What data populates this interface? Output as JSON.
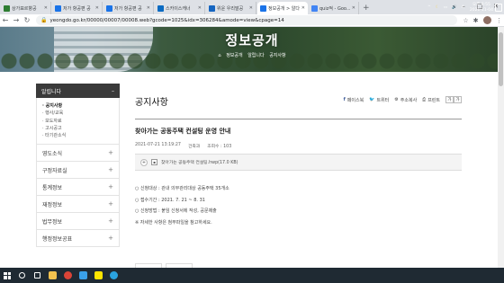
{
  "browser": {
    "tabs": [
      {
        "title": "상가표르향공",
        "color": "#2e7d32",
        "active": false
      },
      {
        "title": "저가 항공편 공",
        "color": "#1a73e8",
        "active": false
      },
      {
        "title": "저가 항공편 공",
        "color": "#1a73e8",
        "active": false
      },
      {
        "title": "스카이스캐너",
        "color": "#0b6bc2",
        "active": false
      },
      {
        "title": "위운 우리말공",
        "color": "#1565c0",
        "active": false
      },
      {
        "title": "정보공개 > 알다",
        "color": "#1a73e8",
        "active": true
      },
      {
        "title": "quiz적 - Goo...",
        "color": "#4285f4",
        "active": false
      }
    ],
    "url": "yeongdo.go.kr/00000/00007/00008.web?gcode=1025&idx=306284&amode=view&cpage=14",
    "new_tab": "+",
    "window_controls": [
      "–",
      "□",
      "✕"
    ]
  },
  "hero": {
    "title": "정보공개",
    "breadcrumb": [
      "⌂",
      "정보공개",
      "알립니다",
      "공지사항"
    ]
  },
  "sidebar": {
    "title": "알립니다",
    "collapse": "–",
    "subitems": [
      {
        "label": "· 공지사항",
        "current": true
      },
      {
        "label": "· 행사/교육",
        "current": false
      },
      {
        "label": "· 보도자료",
        "current": false
      },
      {
        "label": "· 고시공고",
        "current": false
      },
      {
        "label": "· 타기관소식",
        "current": false
      }
    ],
    "categories": [
      "영도소식",
      "구정자료실",
      "통계정보",
      "재정정보",
      "법무정보",
      "행정정보공표"
    ],
    "expand": "+"
  },
  "main": {
    "page_title": "공지사항",
    "share": {
      "facebook": "페이스북",
      "twitter": "트위터",
      "copy": "주소복사",
      "print": "프린트"
    },
    "font_buttons": [
      "가",
      "가"
    ],
    "post_title": "찾아가는 공동주택 컨설팅 운영 안내",
    "date": "2021-07-21 13:19:27",
    "department": "건축과",
    "views": "조회수 : 103",
    "attachment": "찾아가는 공동주택 컨설팅.hwp(17.0 KB)",
    "body": [
      "○ 신청대상 : 관내 의무관리대상 공동주택 35개소",
      "○ 접수기간 : 2021. 7. 21 ~ 8. 31",
      "○ 신청방법 : 붙임 신청서에 작성, 공문제출",
      "※ 자세한 사항은 첨부파일을 참고하세요."
    ]
  },
  "taskbar": {
    "apps": [
      {
        "name": "search",
        "color": "#ffffff"
      },
      {
        "name": "task-view",
        "color": "#ffffff"
      },
      {
        "name": "file-explorer",
        "color": "#f2c14e"
      },
      {
        "name": "chrome",
        "color": "#db4437"
      },
      {
        "name": "hwp",
        "color": "#3aa0e8"
      },
      {
        "name": "kakaotalk",
        "color": "#fee500"
      },
      {
        "name": "edge",
        "color": "#2aa3e0"
      }
    ],
    "time": "오후 8:55",
    "date": "2021-11-04",
    "ime": "A",
    "lang": "ENG"
  }
}
